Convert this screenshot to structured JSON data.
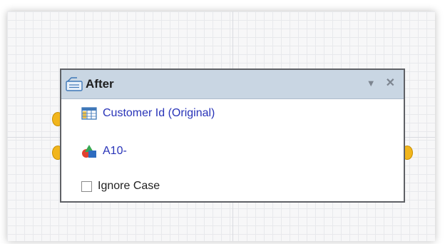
{
  "node": {
    "title": "After",
    "icons": {
      "header": "card-icon",
      "menu": "dropdown-triangle-icon",
      "close": "close-icon",
      "column": "table-column-icon",
      "shapes": "shapes-icon"
    },
    "menu_glyph": "▼",
    "close_glyph": "✕",
    "fields": [
      {
        "label": "Customer Id (Original)"
      },
      {
        "label": "A10-"
      }
    ],
    "ignore_case": {
      "label": "Ignore Case",
      "checked": false
    }
  },
  "colors": {
    "header_bg": "#c9d6e3",
    "link": "#2833b8",
    "port": "#f1b51c",
    "border": "#5f6166"
  }
}
